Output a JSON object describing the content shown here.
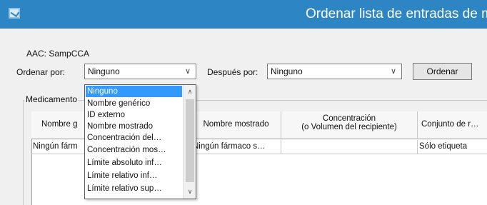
{
  "window": {
    "title": "Ordenar lista de entradas de me"
  },
  "aac": {
    "label": "AAC: SampCCA"
  },
  "sort": {
    "ordenar_label": "Ordenar por:",
    "ordenar_value": "Ninguno",
    "despues_label": "Después por:",
    "despues_value": "Ninguno",
    "button_label": "Ordenar"
  },
  "dropdown": {
    "items": [
      "Ninguno",
      "Nombre genérico",
      "ID externo",
      "Nombre mostrado",
      "Concentración del…",
      "Concentración mos…",
      "Límite absoluto inf…",
      "Límite relativo inf…",
      "Límite relativo sup…"
    ]
  },
  "group": {
    "title": "Medicamento"
  },
  "table": {
    "headers": {
      "nombre_generico": "Nombre g",
      "nombre_mostrado": "Nombre mostrado",
      "concentracion_1": "Concentración",
      "concentracion_2": "(o Volumen del recipiente)",
      "conjunto": "Conjunto de r…"
    },
    "row1": {
      "nombre_generico": "Ningún fárm",
      "nombre_mostrado": "Ningún fármaco s…",
      "concentracion": "",
      "conjunto": "Sólo etiqueta"
    }
  }
}
